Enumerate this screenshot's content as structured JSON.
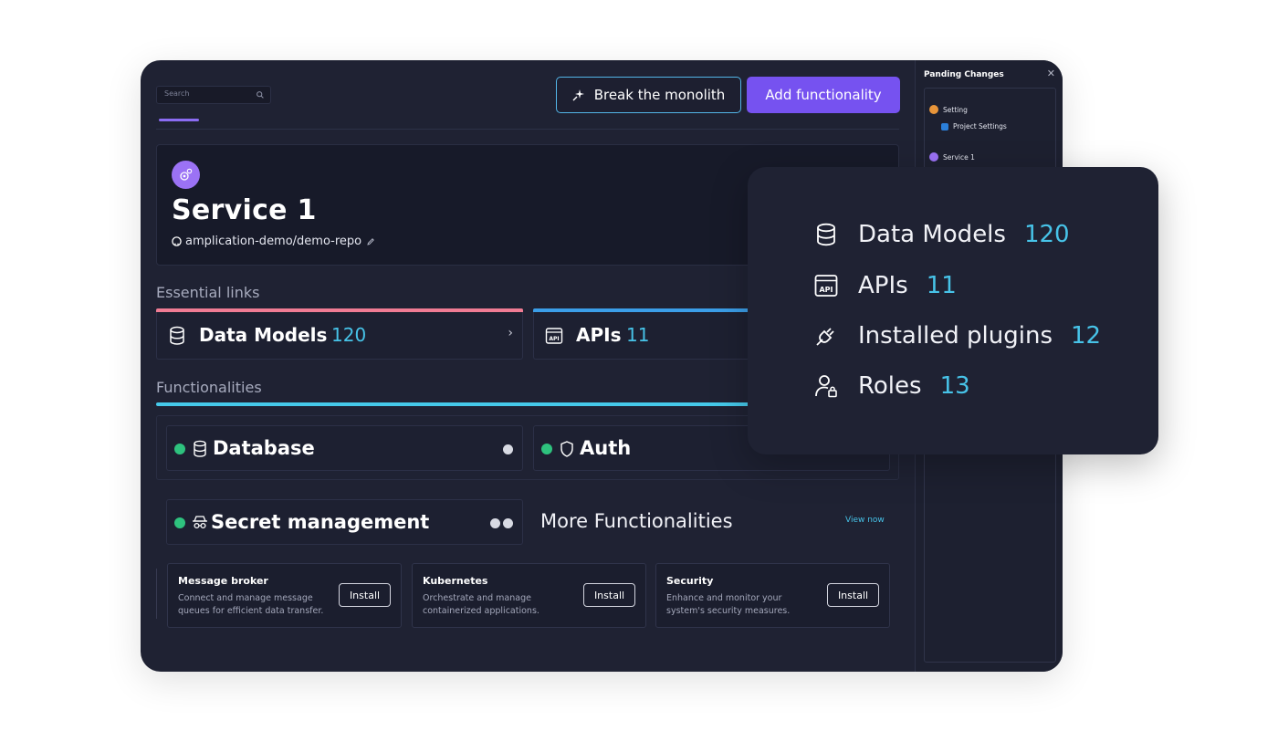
{
  "header": {
    "search_placeholder": "Search",
    "break_button": "Break the monolith",
    "add_button": "Add functionality"
  },
  "service": {
    "title": "Service 1",
    "repo": "amplication-demo/demo-repo"
  },
  "essential_links": {
    "label": "Essential links",
    "items": [
      {
        "label": "Data Models",
        "count": "120",
        "bar_color": "#f07c94"
      },
      {
        "label": "APIs",
        "count": "11",
        "bar_color": "#3b9ee8"
      }
    ]
  },
  "functionalities": {
    "label": "Functionalities",
    "items": [
      {
        "label": "Database"
      },
      {
        "label": "Auth"
      },
      {
        "label": "Secret management"
      }
    ]
  },
  "more": {
    "title": "More Functionalities",
    "view_now": "View now",
    "plugins": [
      {
        "title": "Message broker",
        "desc": "Connect and manage message queues for efficient data transfer.",
        "button": "Install"
      },
      {
        "title": "Kubernetes",
        "desc": "Orchestrate and manage containerized applications.",
        "button": "Install"
      },
      {
        "title": "Security",
        "desc": "Enhance and monitor your system's security measures.",
        "button": "Install"
      }
    ]
  },
  "pending": {
    "title": "Panding Changes",
    "items": [
      {
        "label": "Setting"
      },
      {
        "label": "Project Settings"
      },
      {
        "label": "Service 1"
      }
    ]
  },
  "overlay": {
    "items": [
      {
        "label": "Data Models",
        "count": "120",
        "icon": "database-icon"
      },
      {
        "label": "APIs",
        "count": "11",
        "icon": "api-icon"
      },
      {
        "label": "Installed plugins",
        "count": "12",
        "icon": "plug-icon"
      },
      {
        "label": "Roles",
        "count": "13",
        "icon": "user-lock-icon"
      }
    ]
  },
  "colors": {
    "background": "#1f2233",
    "accent_purple": "#7652f0",
    "accent_cyan": "#47c3e8",
    "status_green": "#2ec27e"
  }
}
